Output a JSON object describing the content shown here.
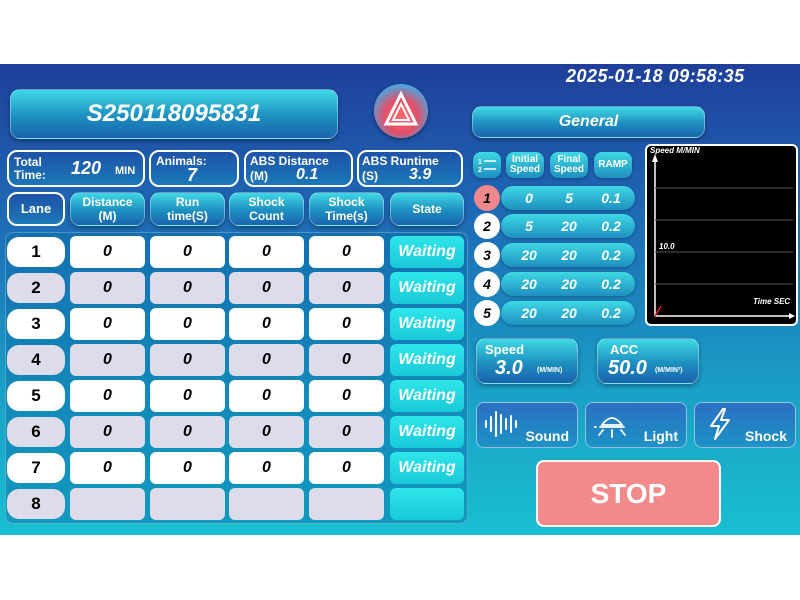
{
  "datetime": "2025-01-18 09:58:35",
  "serial": "S250118095831",
  "mode": "General",
  "stats": {
    "total_time_label": "Total Time:",
    "total_time_value": "120",
    "total_time_unit": "MIN",
    "animals_label": "Animals:",
    "animals_value": "7",
    "abs_distance_label": "ABS Distance",
    "abs_distance_unit": "(M)",
    "abs_distance_value": "0.1",
    "abs_runtime_label": "ABS Runtime",
    "abs_runtime_unit": "(S)",
    "abs_runtime_value": "3.9"
  },
  "table": {
    "headers": {
      "lane": "Lane",
      "distance": "Distance (M)",
      "runtime": "Run time(S)",
      "shock_count": "Shock Count",
      "shock_time": "Shock Time(s)",
      "state": "State"
    },
    "rows": [
      {
        "lane": "1",
        "distance": "0",
        "runtime": "0",
        "shock_count": "0",
        "shock_time": "0",
        "state": "Waiting"
      },
      {
        "lane": "2",
        "distance": "0",
        "runtime": "0",
        "shock_count": "0",
        "shock_time": "0",
        "state": "Waiting"
      },
      {
        "lane": "3",
        "distance": "0",
        "runtime": "0",
        "shock_count": "0",
        "shock_time": "0",
        "state": "Waiting"
      },
      {
        "lane": "4",
        "distance": "0",
        "runtime": "0",
        "shock_count": "0",
        "shock_time": "0",
        "state": "Waiting"
      },
      {
        "lane": "5",
        "distance": "0",
        "runtime": "0",
        "shock_count": "0",
        "shock_time": "0",
        "state": "Waiting"
      },
      {
        "lane": "6",
        "distance": "0",
        "runtime": "0",
        "shock_count": "0",
        "shock_time": "0",
        "state": "Waiting"
      },
      {
        "lane": "7",
        "distance": "0",
        "runtime": "0",
        "shock_count": "0",
        "shock_time": "0",
        "state": "Waiting"
      },
      {
        "lane": "8",
        "distance": "",
        "runtime": "",
        "shock_count": "",
        "shock_time": "",
        "state": ""
      }
    ]
  },
  "segments": {
    "headers": {
      "initial": "Initial Speed",
      "final": "Final Speed",
      "ramp": "RAMP"
    },
    "rows": [
      {
        "num": "1",
        "initial": "0",
        "final": "5",
        "ramp": "0.1",
        "selected": true
      },
      {
        "num": "2",
        "initial": "5",
        "final": "20",
        "ramp": "0.2",
        "selected": false
      },
      {
        "num": "3",
        "initial": "20",
        "final": "20",
        "ramp": "0.2",
        "selected": false
      },
      {
        "num": "4",
        "initial": "20",
        "final": "20",
        "ramp": "0.2",
        "selected": false
      },
      {
        "num": "5",
        "initial": "20",
        "final": "20",
        "ramp": "0.2",
        "selected": false
      }
    ]
  },
  "graph": {
    "ylabel": "Speed M/MIN",
    "xlabel": "Time SEC",
    "tick": "10.0"
  },
  "speed": {
    "label": "Speed",
    "value": "3.0",
    "unit": "(M/MIN)"
  },
  "acc": {
    "label": "ACC",
    "value": "50.0",
    "unit": "(M/MIN²)"
  },
  "tools": {
    "sound": "Sound",
    "light": "Light",
    "shock": "Shock"
  },
  "stop_label": "STOP",
  "colors": {
    "stop": "#f28a8c",
    "state": "#19c9d8",
    "selected_segment": "#f0898c"
  }
}
